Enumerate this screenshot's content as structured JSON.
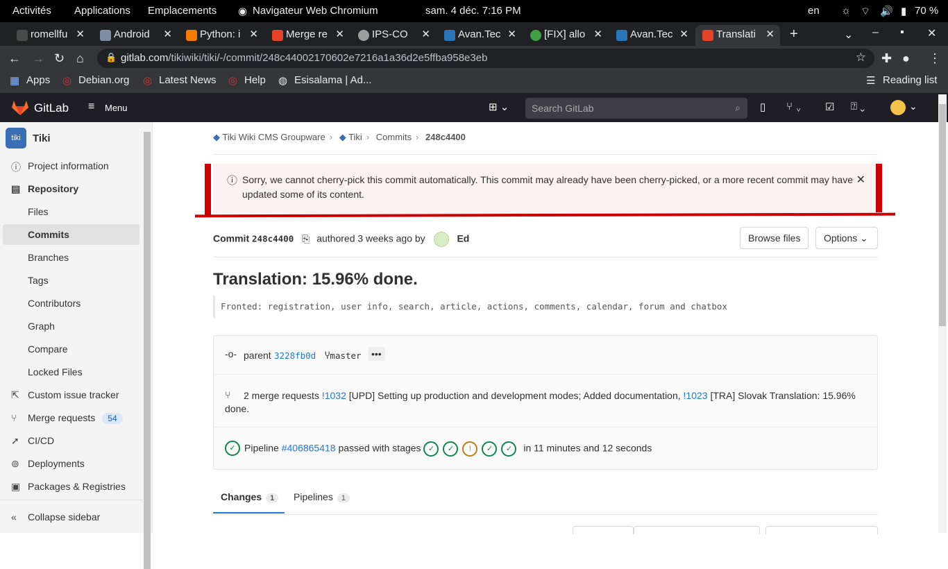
{
  "os_bar": {
    "activities": "Activités",
    "applications": "Applications",
    "places": "Emplacements",
    "app_name": "Navigateur Web Chromium",
    "clock": "sam. 4 déc.  7:16 PM",
    "lang": "en",
    "battery": "70 %"
  },
  "tabs": [
    {
      "title": "romellfu",
      "color": "#4a4a4a"
    },
    {
      "title": "Android",
      "color": "#7d8ea5"
    },
    {
      "title": "Python: i",
      "color": "#f57c00"
    },
    {
      "title": "Merge re",
      "color": "#e24329"
    },
    {
      "title": "IPS-CO",
      "color": "#9e9e9e"
    },
    {
      "title": "Avan.Tec",
      "color": "#2b76b9"
    },
    {
      "title": "[FIX] allo",
      "color": "#43a047"
    },
    {
      "title": "Avan.Tec",
      "color": "#2b76b9"
    },
    {
      "title": "Translati",
      "color": "#e24329"
    }
  ],
  "address": {
    "domain": "gitlab.com",
    "path": "/tikiwiki/tiki/-/commit/248c44002170602e7216a1a36d2e5ffba958e3eb"
  },
  "bookmarks": {
    "apps": "Apps",
    "debian": "Debian.org",
    "news": "Latest News",
    "help": "Help",
    "esisalama": "Esisalama | Ad...",
    "reading": "Reading list"
  },
  "gitlab": {
    "brand": "GitLab",
    "menu": "Menu",
    "search_placeholder": "Search GitLab"
  },
  "sidebar": {
    "project": "Tiki",
    "items": [
      {
        "label": "Project information",
        "icon": "info-icon"
      },
      {
        "label": "Repository",
        "icon": "book-icon"
      },
      {
        "label": "Files"
      },
      {
        "label": "Commits"
      },
      {
        "label": "Branches"
      },
      {
        "label": "Tags"
      },
      {
        "label": "Contributors"
      },
      {
        "label": "Graph"
      },
      {
        "label": "Compare"
      },
      {
        "label": "Locked Files"
      },
      {
        "label": "Custom issue tracker",
        "icon": "external-link-icon"
      },
      {
        "label": "Merge requests",
        "icon": "merge-request-icon",
        "badge": "54"
      },
      {
        "label": "CI/CD",
        "icon": "rocket-icon"
      },
      {
        "label": "Deployments",
        "icon": "deployments-icon"
      },
      {
        "label": "Packages & Registries",
        "icon": "package-icon"
      }
    ],
    "collapse": "Collapse sidebar"
  },
  "breadcrumb": [
    "Tiki Wiki CMS Groupware",
    "Tiki",
    "Commits",
    "248c4400"
  ],
  "alert": {
    "text": "Sorry, we cannot cherry-pick this commit automatically. This commit may already have been cherry-picked, or a more recent commit may have updated some of its content."
  },
  "commit": {
    "label": "Commit",
    "sha": "248c4400",
    "authored": "authored 3 weeks ago by",
    "author": "Ed",
    "browse": "Browse files",
    "options": "Options",
    "title": "Translation: 15.96% done.",
    "description": "Fronted: registration, user info, search, article, actions, comments, calendar, forum and chatbox",
    "parent_label": "parent",
    "parent_sha": "3228fb0d",
    "branch": "master",
    "mr_text": "2 merge requests",
    "mr1": "!1032",
    "mr1_text": "[UPD] Setting up production and development modes; Added documentation,",
    "mr2": "!1023",
    "mr2_text": "[TRA] Slovak Translation: 15.96%",
    "mr2_cont": "done.",
    "pipeline_label": "Pipeline",
    "pipeline": "#406865418",
    "pipeline_status": "passed with stages",
    "pipeline_time": "in 11 minutes and 12 seconds"
  },
  "content_tabs": [
    {
      "label": "Changes",
      "count": "1"
    },
    {
      "label": "Pipelines",
      "count": "1"
    }
  ]
}
